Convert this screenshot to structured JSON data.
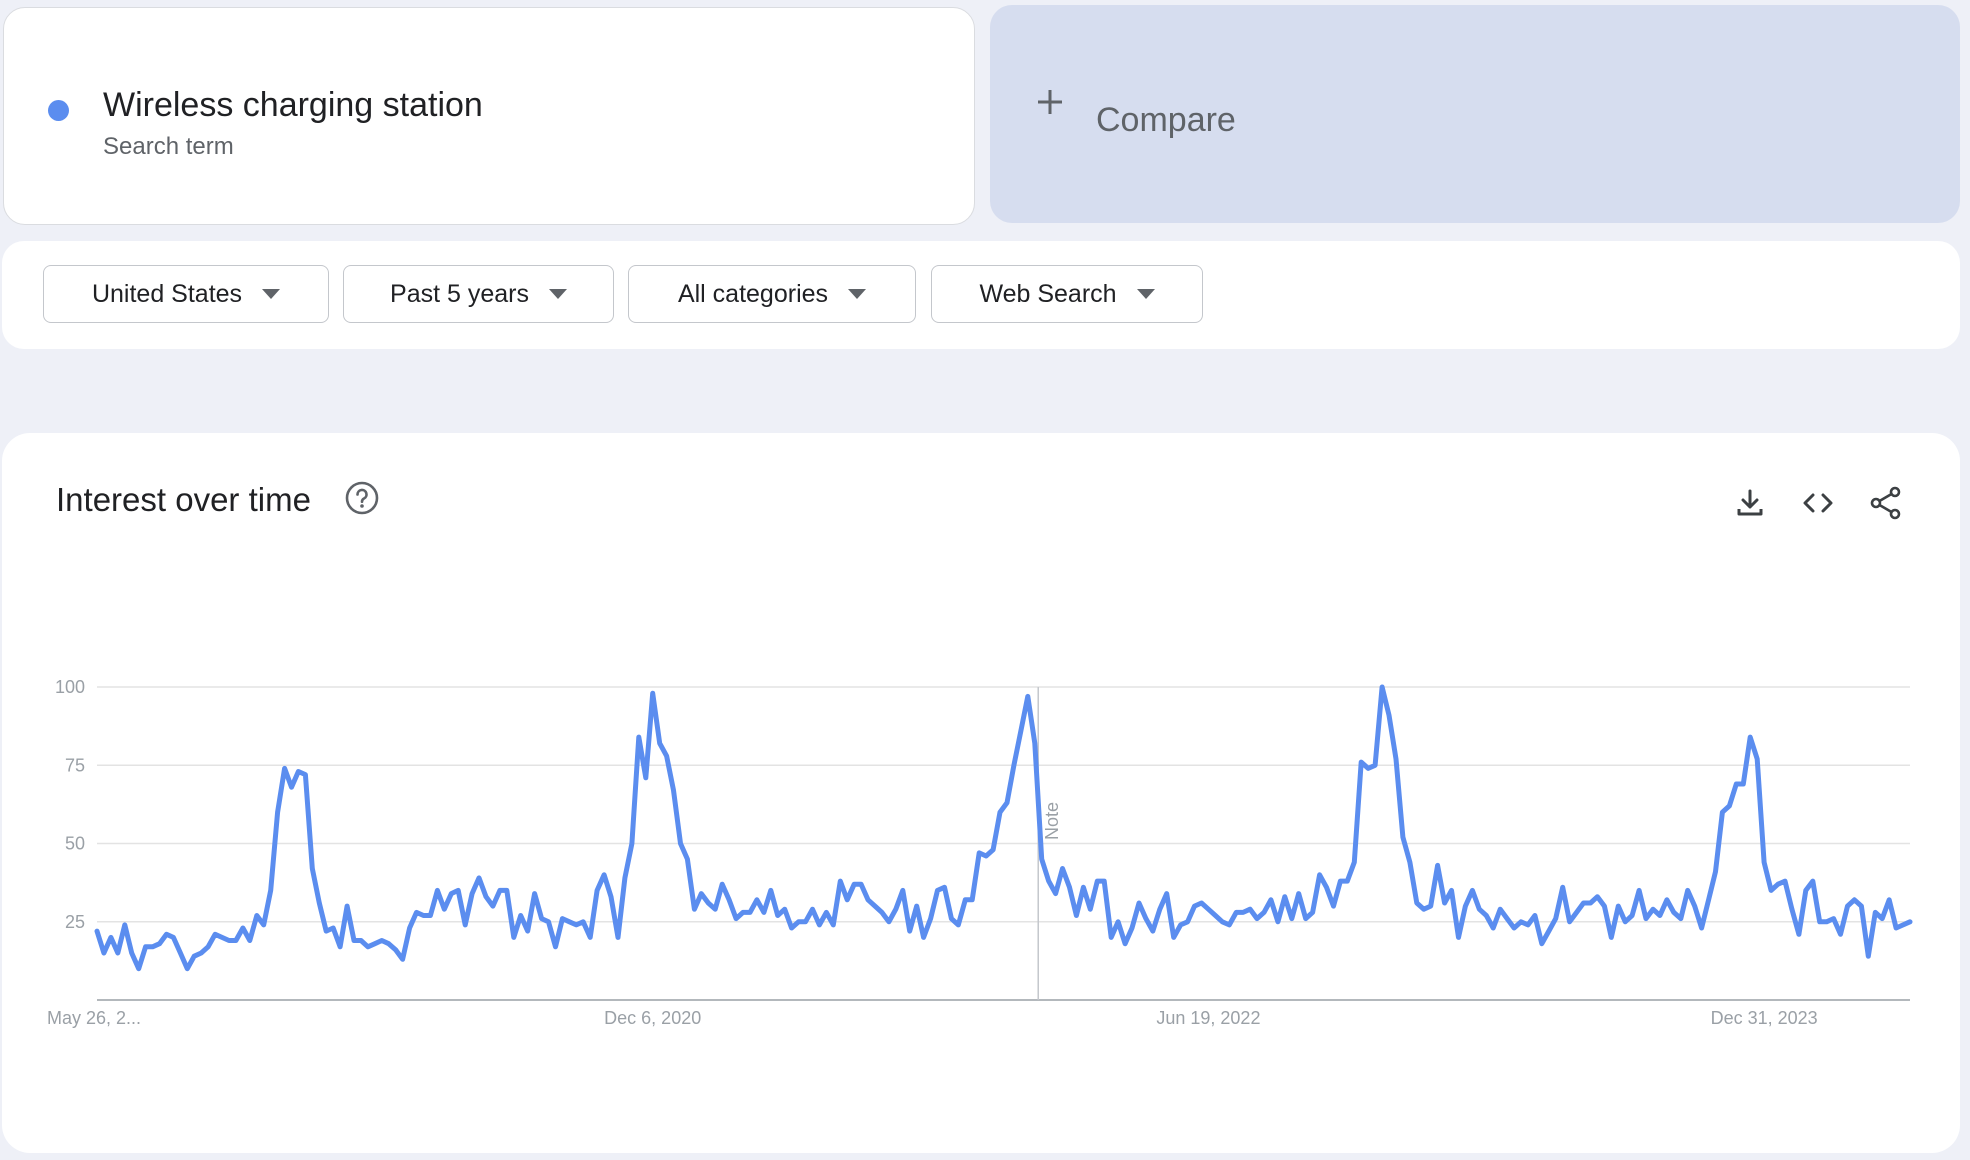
{
  "search_term": {
    "name": "Wireless charging station",
    "subtitle": "Search term",
    "color": "#5b8def"
  },
  "compare": {
    "label": "Compare"
  },
  "filters": [
    {
      "label": "United States"
    },
    {
      "label": "Past 5 years"
    },
    {
      "label": "All categories"
    },
    {
      "label": "Web Search"
    }
  ],
  "chart_panel": {
    "title": "Interest over time",
    "icons": [
      "help-icon",
      "download-icon",
      "embed-code-icon",
      "share-icon"
    ]
  },
  "chart_data": {
    "type": "line",
    "x_tick_labels": [
      "May 26, 2...",
      "Dec 6, 2020",
      "Jun 19, 2022",
      "Dec 31, 2023"
    ],
    "ylim": [
      0,
      100
    ],
    "y_ticks": [
      25,
      50,
      75,
      100
    ],
    "grid": true,
    "annotation": "Note",
    "series": [
      {
        "color": "#5b8def",
        "values": [
          22,
          15,
          20,
          15,
          24,
          15,
          10,
          17,
          17,
          18,
          21,
          20,
          15,
          10,
          14,
          15,
          17,
          21,
          20,
          19,
          19,
          23,
          19,
          27,
          24,
          35,
          60,
          74,
          68,
          73,
          72,
          42,
          31,
          22,
          23,
          17,
          30,
          19,
          19,
          17,
          18,
          19,
          18,
          16,
          13,
          23,
          28,
          27,
          27,
          35,
          29,
          34,
          35,
          24,
          34,
          39,
          33,
          30,
          35,
          35,
          20,
          27,
          22,
          34,
          26,
          25,
          17,
          26,
          25,
          24,
          25,
          20,
          35,
          40,
          33,
          20,
          39,
          50,
          84,
          71,
          98,
          82,
          78,
          67,
          50,
          45,
          29,
          34,
          31,
          29,
          37,
          32,
          26,
          28,
          28,
          32,
          28,
          35,
          27,
          29,
          23,
          25,
          25,
          29,
          24,
          28,
          24,
          38,
          32,
          37,
          37,
          32,
          30,
          28,
          25,
          29,
          35,
          22,
          30,
          20,
          26,
          35,
          36,
          26,
          24,
          32,
          32,
          47,
          46,
          48,
          60,
          63,
          75,
          86,
          97,
          82,
          45,
          38,
          34,
          42,
          36,
          27,
          36,
          29,
          38,
          38,
          20,
          25,
          18,
          23,
          31,
          26,
          22,
          29,
          34,
          20,
          24,
          25,
          30,
          31,
          29,
          27,
          25,
          24,
          28,
          28,
          29,
          26,
          28,
          32,
          25,
          33,
          26,
          34,
          26,
          28,
          40,
          36,
          30,
          38,
          38,
          44,
          76,
          74,
          75,
          100,
          91,
          77,
          52,
          44,
          31,
          29,
          30,
          43,
          31,
          35,
          20,
          30,
          35,
          29,
          27,
          23,
          29,
          26,
          23,
          25,
          24,
          27,
          18,
          22,
          26,
          36,
          25,
          28,
          31,
          31,
          33,
          30,
          20,
          30,
          25,
          27,
          35,
          26,
          29,
          27,
          32,
          28,
          26,
          35,
          30,
          23,
          32,
          41,
          60,
          62,
          69,
          69,
          84,
          77,
          44,
          35,
          37,
          38,
          29,
          21,
          35,
          38,
          25,
          25,
          26,
          21,
          30,
          32,
          30,
          14,
          28,
          26,
          32,
          23,
          24,
          25
        ]
      }
    ]
  }
}
